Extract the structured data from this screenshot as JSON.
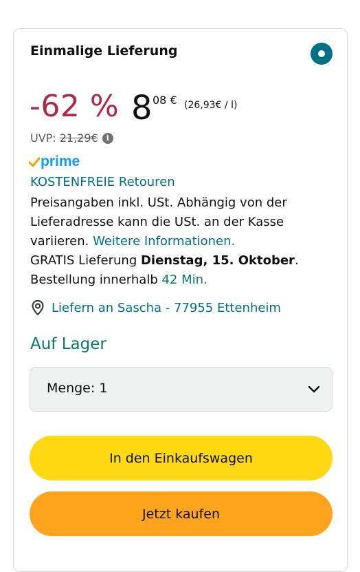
{
  "offer": {
    "title": "Einmalige Lieferung",
    "discount": "-62 %",
    "price_whole": "8",
    "price_fraction": "08 €",
    "unit_price": "(26,93€ / l)",
    "uvp_label": "UVP:",
    "uvp_value": "21,29€",
    "prime_label": "prime",
    "returns": "KOSTENFREIE Retouren",
    "tax_text": "Preisangaben inkl. USt. Abhängig von der Lieferadresse kann die USt. an der Kasse variieren.",
    "more_info_link": "Weitere Informationen.",
    "delivery_prefix": "GRATIS Lieferung",
    "delivery_date": "Dienstag, 15. Oktober",
    "order_within_prefix": "Bestellung innerhalb",
    "order_within_time": "42 Min.",
    "deliver_to": "Liefern an Sascha - 77955 Ettenheim",
    "stock": "Auf Lager",
    "quantity_label": "Menge: 1",
    "add_to_cart": "In den Einkaufswagen",
    "buy_now": "Jetzt kaufen"
  },
  "colors": {
    "discount": "#b12748",
    "link": "#007185",
    "in_stock": "#067d62",
    "prime_blue": "#1399ff",
    "prime_check": "#f7a200",
    "cart_button": "#ffd814",
    "buy_button": "#ffa41c"
  },
  "icons": {
    "radio": "radio-selected-icon",
    "info": "info-icon",
    "prime_check": "checkmark-icon",
    "location": "location-pin-icon",
    "dropdown": "chevron-down-icon"
  }
}
